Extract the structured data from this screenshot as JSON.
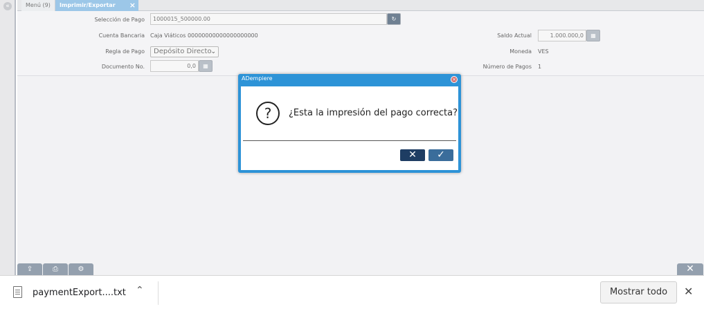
{
  "tabs": {
    "menu_label": "Menú (9)",
    "active_label": "Imprimir/Exportar Pagos"
  },
  "form": {
    "payment_selection_label": "Selección de Pago",
    "payment_selection_value": "1000015_500000.00",
    "bank_account_label": "Cuenta Bancaria",
    "bank_account_value": "Caja Viáticos 00000000000000000000",
    "payment_rule_label": "Regla de Pago",
    "payment_rule_value": "Depósito Directo",
    "document_no_label": "Documento No.",
    "document_no_value": "0,0",
    "current_balance_label": "Saldo Actual",
    "current_balance_value": "1.000.000,0",
    "currency_label": "Moneda",
    "currency_value": "VES",
    "payment_count_label": "Número de Pagos",
    "payment_count_value": "1"
  },
  "dialog": {
    "title": "ADempiere",
    "message": "¿Esta la impresión del pago correcta?",
    "icon": "question-icon"
  },
  "download_bar": {
    "file_name": "paymentExport....txt",
    "show_all_label": "Mostrar todo"
  },
  "colors": {
    "dialog_border": "#2d93d7",
    "active_tab": "#9cc7e8",
    "cancel_button": "#1e3d63",
    "ok_button": "#3a6d9b"
  }
}
